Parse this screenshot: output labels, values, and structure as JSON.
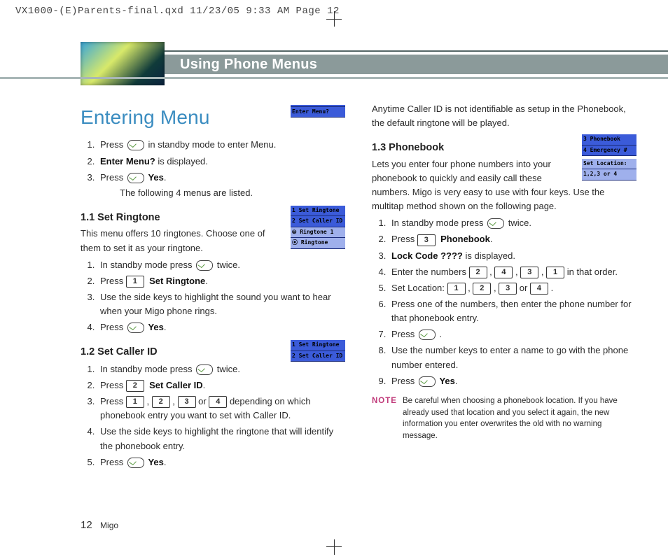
{
  "slug": "VX1000-(E)Parents-final.qxd  11/23/05  9:33 AM  Page 12",
  "header": {
    "title": "Using Phone Menus"
  },
  "main_heading": "Entering Menu",
  "screen_enter": {
    "l1": "",
    "l2": "Enter Menu?"
  },
  "screen_ringtone": {
    "l1": "1 Set Ringtone",
    "l2": "2 Set Caller ID",
    "l3": "⦾ Ringtone 1",
    "l4": "⦿ Ringtone"
  },
  "screen_caller": {
    "l1": "1 Set Ringtone",
    "l2": "2 Set Caller ID"
  },
  "screen_phonebook": {
    "l1": "3 Phonebook",
    "l2": "4 Emergency #",
    "l3": "Set Location:",
    "l4": "1,2,3 or 4"
  },
  "col1": {
    "intro_steps": {
      "s1a": "Press ",
      "s1b": " in standby mode to enter Menu.",
      "s2a": "Enter Menu?",
      "s2b": "  is displayed.",
      "s3a": "Press  ",
      "s3b": "Yes",
      "s3c": "The following 4 menus are listed."
    },
    "sec11_title": "1.1 Set Ringtone",
    "sec11_lead": "This menu offers 10 ringtones. Choose one of them to set it as your ringtone.",
    "sec11_steps": {
      "s1a": "In standby mode press ",
      "s1b": " twice.",
      "s2a": "Press  ",
      "s2k": "1",
      "s2b": "Set Ringtone",
      "s3": "Use the side keys to highlight the sound you want to hear when your Migo phone rings.",
      "s4a": "Press  ",
      "s4b": "Yes"
    },
    "sec12_title": "1.2 Set Caller ID",
    "sec12_steps": {
      "s1a": "In standby mode press ",
      "s1b": " twice.",
      "s2a": "Press  ",
      "s2k": "2",
      "s2b": "Set Caller ID",
      "s3a": "Press  ",
      "s3k1": "1",
      "s3k2": "2",
      "s3k3": "3",
      "s3k4": "4",
      "s3b": " depending on which phonebook entry you want to set with Caller ID.",
      "s4": "Use the side keys to highlight the ringtone that will identify the phonebook entry.",
      "s5a": "Press  ",
      "s5b": "Yes"
    }
  },
  "col2": {
    "top": "Anytime Caller ID is not identifiable as setup in the Phonebook, the default ringtone will be played.",
    "sec13_title": "1.3  Phonebook",
    "sec13_lead": "Lets you enter four phone numbers into your phonebook to quickly and easily call these numbers. Migo is very easy to use with four keys. Use the multitap method shown on the following page.",
    "sec13_steps": {
      "s1a": "In standby mode press ",
      "s1b": " twice.",
      "s2a": "Press  ",
      "s2k": "3",
      "s2b": "Phonebook",
      "s3a": "Lock Code ????",
      "s3b": " is displayed.",
      "s4a": "Enter the numbers  ",
      "s4k1": "2",
      "s4k2": "4",
      "s4k3": "3",
      "s4k4": "1",
      "s4b": "  in that order.",
      "s5a": "Set Location:  ",
      "s5k1": "1",
      "s5k2": "2",
      "s5k3": "3",
      "s5k4": "4",
      "s6": "Press one of the numbers, then enter the phone number for that phonebook entry.",
      "s7": "Press  ",
      "s8": "Use the number keys to enter a name to go with the phone number entered.",
      "s9a": "Press  ",
      "s9b": "Yes"
    },
    "note_label": "NOTE",
    "note_text": "Be careful when choosing a phonebook location. If you have already used that location and you select it again, the new information you enter overwrites the old with no warning message."
  },
  "footer": {
    "page": "12",
    "product": "Migo"
  }
}
